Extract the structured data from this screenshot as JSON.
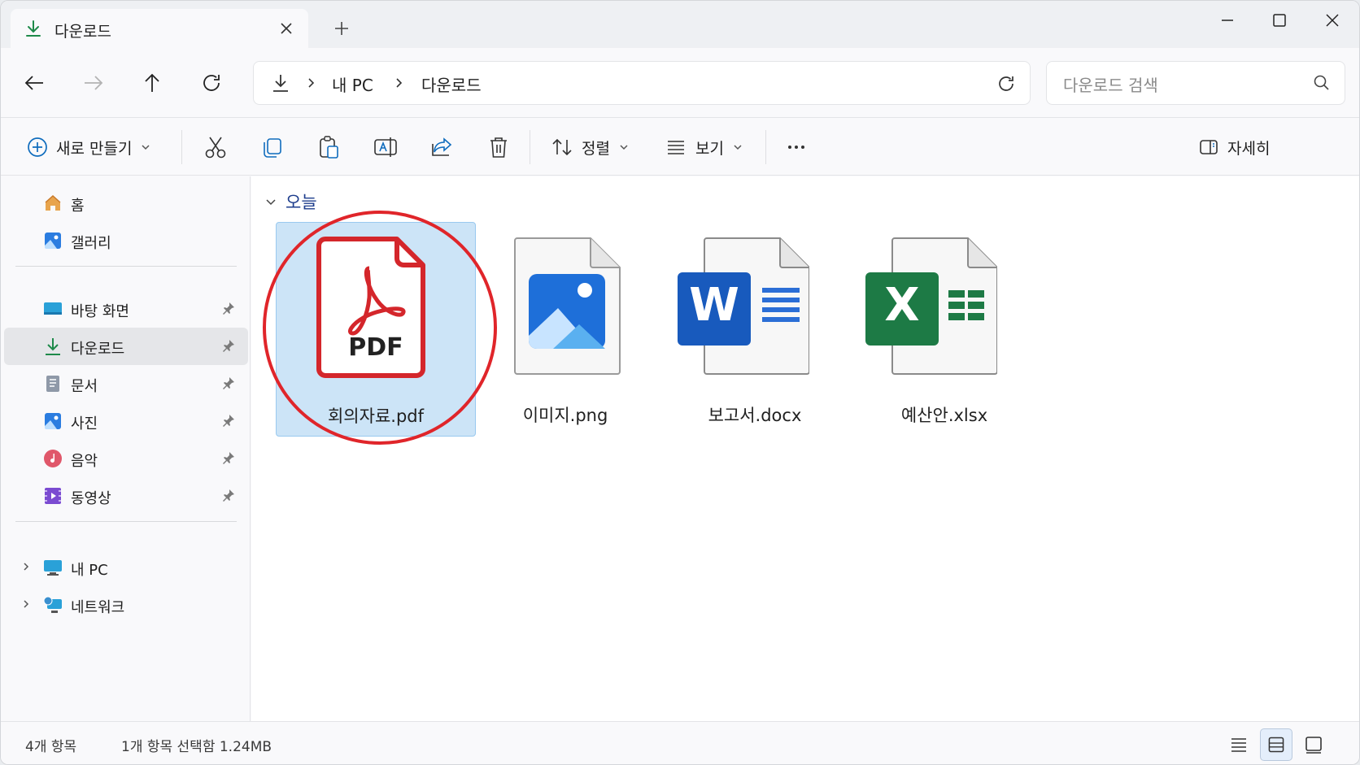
{
  "tab": {
    "title": "다운로드"
  },
  "address": {
    "crumbs": [
      "내 PC",
      "다운로드"
    ]
  },
  "search": {
    "placeholder": "다운로드 검색"
  },
  "commands": {
    "new": "새로 만들기",
    "sort": "정렬",
    "view": "보기",
    "details": "자세히"
  },
  "sidebar": {
    "items": [
      {
        "label": "홈"
      },
      {
        "label": "갤러리"
      },
      {
        "label": "바탕 화면"
      },
      {
        "label": "다운로드"
      },
      {
        "label": "문서"
      },
      {
        "label": "사진"
      },
      {
        "label": "음악"
      },
      {
        "label": "동영상"
      },
      {
        "label": "내 PC"
      },
      {
        "label": "네트워크"
      }
    ]
  },
  "group": {
    "label": "오늘"
  },
  "files": [
    {
      "name": "회의자료.pdf",
      "type": "pdf-icon",
      "badge": "PDF"
    },
    {
      "name": "이미지.png",
      "type": "image-file-icon"
    },
    {
      "name": "보고서.docx",
      "type": "word-icon",
      "badge": "W"
    },
    {
      "name": "예산안.xlsx",
      "type": "excel-icon",
      "badge": "X"
    }
  ],
  "status": {
    "count": "4개 항목",
    "selection": "1개 항목 선택함 1.24MB"
  },
  "colors": {
    "accent": "#0f6cbd",
    "selection": "#cce4f7",
    "annotation": "#e0252a",
    "pdf": "#d4262b",
    "word": "#185abd",
    "excel": "#1d7a45"
  }
}
